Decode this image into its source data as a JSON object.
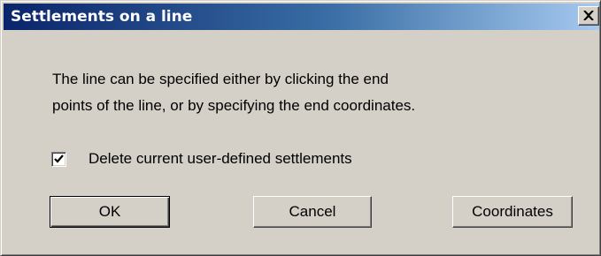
{
  "dialog": {
    "title": "Settlements on a line",
    "close_icon": "close-icon",
    "message_lines": [
      "The line can be specified either by clicking the end",
      "points of the line, or by specifying the end coordinates."
    ],
    "checkbox": {
      "label": "Delete current user-defined settlements",
      "checked": true
    },
    "buttons": {
      "ok": "OK",
      "cancel": "Cancel",
      "coordinates": "Coordinates"
    }
  },
  "colors": {
    "titlebar_start": "#0a246a",
    "titlebar_end": "#a6caf0",
    "face": "#d4d0c8"
  }
}
